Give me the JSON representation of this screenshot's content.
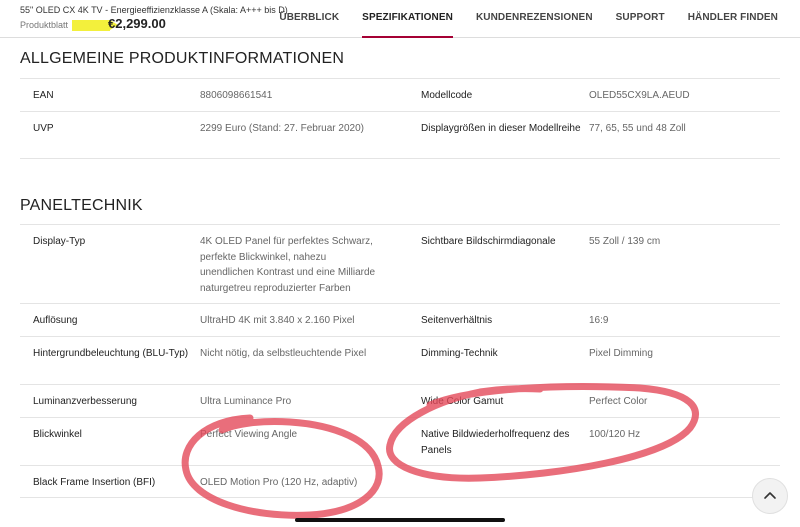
{
  "header": {
    "product_title": "55\" OLED CX 4K TV - Energieeffizienzklasse A (Skala: A+++ bis D)",
    "produktblatt": "Produktblatt",
    "price": "€2,299.00",
    "nav": [
      "ÜBERBLICK",
      "SPEZIFIKATIONEN",
      "KUNDENREZENSIONEN",
      "SUPPORT",
      "HÄNDLER FINDEN"
    ],
    "active_tab": "SPEZIFIKATIONEN",
    "accent": "#a50034"
  },
  "general": {
    "title": "ALLGEMEINE PRODUKTINFORMATIONEN",
    "rows": [
      {
        "k1": "EAN",
        "v1": "8806098661541",
        "k2": "Modellcode",
        "v2": "OLED55CX9LA.AEUD"
      },
      {
        "k1": "UVP",
        "v1": "2299 Euro (Stand: 27. Februar 2020)",
        "k2": "Displaygrößen in dieser Modellreihe",
        "v2": "77, 65, 55 und 48 Zoll"
      }
    ]
  },
  "panel": {
    "title": "PANELTECHNIK",
    "rows": [
      {
        "k1": "Display-Typ",
        "v1": "4K OLED Panel für perfektes Schwarz, perfekte Blickwinkel, nahezu unendlichen Kontrast und eine Milliarde naturgetreu reproduzierter Farben",
        "k2": "Sichtbare Bildschirmdiagonale",
        "v2": "55 Zoll / 139 cm"
      },
      {
        "k1": "Auflösung",
        "v1": "UltraHD 4K mit 3.840 x 2.160 Pixel",
        "k2": "Seitenverhältnis",
        "v2": "16:9"
      },
      {
        "k1": "Hintergrundbeleuchtung (BLU-Typ)",
        "v1": "Nicht nötig, da selbstleuchtende Pixel",
        "k2": "Dimming-Technik",
        "v2": "Pixel Dimming"
      },
      {
        "k1": "Luminanzverbesserung",
        "v1": "Ultra Luminance Pro",
        "k2": "Wide Color Gamut",
        "v2": "Perfect Color"
      },
      {
        "k1": "Blickwinkel",
        "v1": "Perfect Viewing Angle",
        "k2": "Native Bildwiederholfrequenz des Panels",
        "v2": "100/120 Hz"
      },
      {
        "k1": "Black Frame Insertion (BFI)",
        "v1": "OLED Motion Pro (120 Hz, adaptiv)",
        "k2": "",
        "v2": ""
      }
    ]
  },
  "icons": {
    "scroll_top": "chevron-up-icon",
    "highlight": "yellow-highlighter-mark",
    "annotation": "red-marker-circles"
  }
}
